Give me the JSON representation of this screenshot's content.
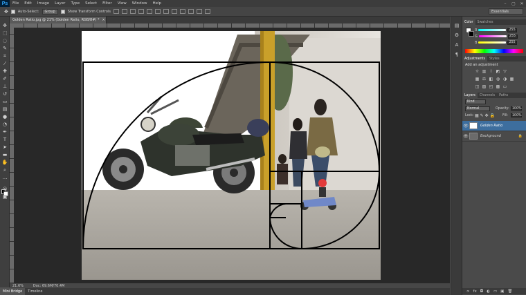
{
  "app": {
    "logo": "Ps"
  },
  "menu": [
    "File",
    "Edit",
    "Image",
    "Layer",
    "Type",
    "Select",
    "Filter",
    "View",
    "Window",
    "Help"
  ],
  "window_controls": [
    "–",
    "▢",
    "✕"
  ],
  "options_bar": {
    "auto_select_label": "Auto-Select:",
    "auto_select_value": "Group",
    "show_transform_label": "Show Transform Controls",
    "workspace": "Essentials"
  },
  "document_tab": {
    "title": "Golden Ratio.jpg @ 21% (Golden Ratio, RGB/8#) *",
    "close": "×"
  },
  "status": {
    "zoom": "21.6%",
    "doc": "Doc: 69.6M/70.4M"
  },
  "bottom_tabs": [
    "Mini Bridge",
    "Timeline"
  ],
  "color_panel": {
    "tabs": [
      "Color",
      "Swatches"
    ],
    "channels": [
      {
        "label": "R",
        "value": "255"
      },
      {
        "label": "G",
        "value": "255"
      },
      {
        "label": "B",
        "value": "255"
      }
    ]
  },
  "adjustments_panel": {
    "tabs": [
      "Adjustments",
      "Styles"
    ],
    "heading": "Add an adjustment"
  },
  "layers_panel": {
    "tabs": [
      "Layers",
      "Channels",
      "Paths"
    ],
    "kind_filter": "Kind",
    "blend_mode": "Normal",
    "opacity_label": "Opacity:",
    "opacity_value": "100%",
    "lock_label": "Lock:",
    "fill_label": "Fill:",
    "fill_value": "100%",
    "layers": [
      {
        "name": "Golden Ratio",
        "selected": true
      },
      {
        "name": "Background",
        "selected": false
      }
    ]
  },
  "colors": {
    "ui_dark": "#3c3c3c",
    "panel": "#4a4a4a",
    "selection": "#3d6e9e",
    "accent": "#31a8ff"
  }
}
